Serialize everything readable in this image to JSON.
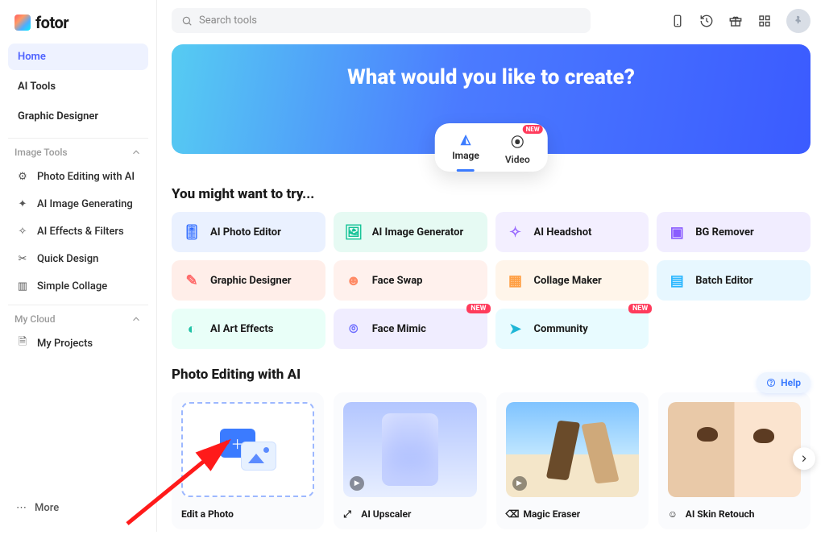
{
  "brand": {
    "name": "fotor"
  },
  "search": {
    "placeholder": "Search tools"
  },
  "sidebar": {
    "primary": [
      {
        "label": "Home",
        "active": true
      },
      {
        "label": "AI Tools",
        "active": false
      },
      {
        "label": "Graphic Designer",
        "active": false
      }
    ],
    "sections": [
      {
        "title": "Image Tools",
        "items": [
          {
            "label": "Photo Editing with AI",
            "icon": "sliders"
          },
          {
            "label": "AI Image Generating",
            "icon": "sparkles"
          },
          {
            "label": "AI Effects & Filters",
            "icon": "wand"
          },
          {
            "label": "Quick Design",
            "icon": "scissors"
          },
          {
            "label": "Simple Collage",
            "icon": "layout"
          }
        ]
      },
      {
        "title": "My Cloud",
        "items": [
          {
            "label": "My Projects",
            "icon": "file"
          }
        ]
      }
    ],
    "more": "More"
  },
  "hero": {
    "title": "What would you like to create?",
    "tabs": [
      {
        "label": "Image",
        "active": true,
        "badge": null
      },
      {
        "label": "Video",
        "active": false,
        "badge": "NEW"
      }
    ]
  },
  "try_section": {
    "title": "You might want to try...",
    "cards": [
      {
        "label": "AI Photo Editor",
        "bg": "bg-blue",
        "icon_color": "c-blue",
        "icon": "sliders",
        "badge": null
      },
      {
        "label": "AI Image Generator",
        "bg": "bg-green",
        "icon_color": "c-green",
        "icon": "image-plus",
        "badge": null
      },
      {
        "label": "AI Headshot",
        "bg": "bg-purple",
        "icon_color": "c-purple",
        "icon": "person",
        "badge": null
      },
      {
        "label": "BG Remover",
        "bg": "bg-violet",
        "icon_color": "c-violet",
        "icon": "eraser",
        "badge": null
      },
      {
        "label": "Graphic Designer",
        "bg": "bg-pink",
        "icon_color": "c-pink",
        "icon": "pencil",
        "badge": null
      },
      {
        "label": "Face Swap",
        "bg": "bg-peach",
        "icon_color": "c-peach",
        "icon": "face",
        "badge": null
      },
      {
        "label": "Collage Maker",
        "bg": "bg-orange",
        "icon_color": "c-orange",
        "icon": "grid",
        "badge": null
      },
      {
        "label": "Batch Editor",
        "bg": "bg-sky",
        "icon_color": "c-sky",
        "icon": "stack",
        "badge": null
      },
      {
        "label": "AI Art Effects",
        "bg": "bg-mint",
        "icon_color": "c-mint",
        "icon": "swirl",
        "badge": null
      },
      {
        "label": "Face Mimic",
        "bg": "bg-lav",
        "icon_color": "c-lav",
        "icon": "scan",
        "badge": "NEW"
      },
      {
        "label": "Community",
        "bg": "bg-cyan",
        "icon_color": "c-cyan",
        "icon": "send",
        "badge": "NEW"
      }
    ]
  },
  "edit_section": {
    "title": "Photo Editing with AI",
    "cards": [
      {
        "label": "Edit a Photo",
        "kind": "upload",
        "icon": null
      },
      {
        "label": "AI Upscaler",
        "kind": "up",
        "icon": "expand"
      },
      {
        "label": "Magic Eraser",
        "kind": "er",
        "icon": "eraser"
      },
      {
        "label": "AI Skin Retouch",
        "kind": "sk",
        "icon": "face"
      }
    ]
  },
  "help": {
    "label": "Help"
  },
  "badges": {
    "new": "NEW"
  }
}
